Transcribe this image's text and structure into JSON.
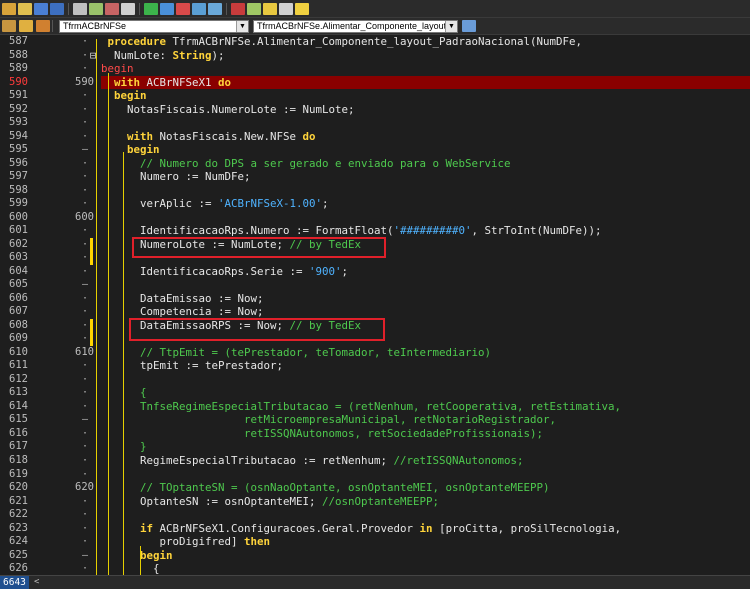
{
  "toolbar": {
    "class_combo": "TfrmACBrNFSe",
    "method_combo": "TfrmACBrNFSe.Alimentar_Componente_layout_Padr"
  },
  "editor": {
    "lines": [
      {
        "n": "587",
        "bm": "",
        "mk": "·",
        "chg": false,
        "bp": false,
        "code": [
          {
            "t": " "
          },
          {
            "t": "procedure",
            "c": "kw"
          },
          {
            "t": " TfrmACBrNFSe.Alimentar_Componente_layout_PadraoNacional(NumDFe,"
          }
        ]
      },
      {
        "n": "588",
        "bm": "",
        "mk": "·",
        "box": "⊟",
        "chg": false,
        "bp": false,
        "code": [
          {
            "t": "  NumLote: "
          },
          {
            "t": "String",
            "c": "kw"
          },
          {
            "t": ");"
          }
        ]
      },
      {
        "n": "589",
        "bm": "",
        "mk": "·",
        "chg": false,
        "bp": false,
        "code": [
          {
            "t": "begin",
            "c": "bp"
          }
        ]
      },
      {
        "n": "590",
        "bm": "590",
        "mk": "·",
        "chg": false,
        "bp": true,
        "code": [
          {
            "t": "  "
          },
          {
            "t": "with",
            "c": "kw"
          },
          {
            "t": " ACBrNFSeX1 "
          },
          {
            "t": "do",
            "c": "kw"
          }
        ]
      },
      {
        "n": "591",
        "bm": "",
        "mk": "·",
        "chg": false,
        "bp": false,
        "code": [
          {
            "t": "  "
          },
          {
            "t": "begin",
            "c": "kw"
          }
        ]
      },
      {
        "n": "592",
        "bm": "",
        "mk": "·",
        "chg": false,
        "bp": false,
        "code": [
          {
            "t": "    NotasFiscais.NumeroLote := NumLote;"
          }
        ]
      },
      {
        "n": "593",
        "bm": "",
        "mk": "·",
        "chg": false,
        "bp": false,
        "code": []
      },
      {
        "n": "594",
        "bm": "",
        "mk": "·",
        "chg": false,
        "bp": false,
        "code": [
          {
            "t": "    "
          },
          {
            "t": "with",
            "c": "kw"
          },
          {
            "t": " NotasFiscais.New.NFSe "
          },
          {
            "t": "do",
            "c": "kw"
          }
        ]
      },
      {
        "n": "595",
        "bm": "",
        "mk": "–",
        "chg": false,
        "bp": false,
        "code": [
          {
            "t": "    "
          },
          {
            "t": "begin",
            "c": "kw"
          }
        ]
      },
      {
        "n": "596",
        "bm": "",
        "mk": "·",
        "chg": false,
        "bp": false,
        "code": [
          {
            "t": "      "
          },
          {
            "t": "// Numero do DPS a ser gerado e enviado para o WebService",
            "c": "cmt"
          }
        ]
      },
      {
        "n": "597",
        "bm": "",
        "mk": "·",
        "chg": false,
        "bp": false,
        "code": [
          {
            "t": "      Numero := NumDFe;"
          }
        ]
      },
      {
        "n": "598",
        "bm": "",
        "mk": "·",
        "chg": false,
        "bp": false,
        "code": []
      },
      {
        "n": "599",
        "bm": "",
        "mk": "·",
        "chg": false,
        "bp": false,
        "code": [
          {
            "t": "      verAplic := "
          },
          {
            "t": "'ACBrNFSeX-1.00'",
            "c": "str"
          },
          {
            "t": ";"
          }
        ]
      },
      {
        "n": "600",
        "bm": "600",
        "mk": "·",
        "chg": false,
        "bp": false,
        "code": []
      },
      {
        "n": "601",
        "bm": "",
        "mk": "·",
        "chg": false,
        "bp": false,
        "code": [
          {
            "t": "      IdentificacaoRps.Numero := FormatFloat("
          },
          {
            "t": "'#########0'",
            "c": "str"
          },
          {
            "t": ", StrToInt(NumDFe));"
          }
        ]
      },
      {
        "n": "602",
        "bm": "",
        "mk": "·",
        "chg": true,
        "bp": false,
        "code": [
          {
            "t": "      NumeroLote := NumLote; "
          },
          {
            "t": "// by TedEx",
            "c": "cmt"
          }
        ]
      },
      {
        "n": "603",
        "bm": "",
        "mk": "·",
        "chg": true,
        "bp": false,
        "code": []
      },
      {
        "n": "604",
        "bm": "",
        "mk": "·",
        "chg": false,
        "bp": false,
        "code": [
          {
            "t": "      IdentificacaoRps.Serie := "
          },
          {
            "t": "'900'",
            "c": "str"
          },
          {
            "t": ";"
          }
        ]
      },
      {
        "n": "605",
        "bm": "",
        "mk": "–",
        "chg": false,
        "bp": false,
        "code": []
      },
      {
        "n": "606",
        "bm": "",
        "mk": "·",
        "chg": false,
        "bp": false,
        "code": [
          {
            "t": "      DataEmissao := Now;"
          }
        ]
      },
      {
        "n": "607",
        "bm": "",
        "mk": "·",
        "chg": false,
        "bp": false,
        "code": [
          {
            "t": "      Competencia := Now;"
          }
        ]
      },
      {
        "n": "608",
        "bm": "",
        "mk": "·",
        "chg": true,
        "bp": false,
        "code": [
          {
            "t": "      DataEmissaoRPS := Now; "
          },
          {
            "t": "// by TedEx",
            "c": "cmt"
          }
        ]
      },
      {
        "n": "609",
        "bm": "",
        "mk": "·",
        "chg": true,
        "bp": false,
        "code": []
      },
      {
        "n": "610",
        "bm": "610",
        "mk": "·",
        "chg": false,
        "bp": false,
        "code": [
          {
            "t": "      "
          },
          {
            "t": "// TtpEmit = (tePrestador, teTomador, teIntermediario)",
            "c": "cmt"
          }
        ]
      },
      {
        "n": "611",
        "bm": "",
        "mk": "·",
        "chg": false,
        "bp": false,
        "code": [
          {
            "t": "      tpEmit := tePrestador;"
          }
        ]
      },
      {
        "n": "612",
        "bm": "",
        "mk": "·",
        "chg": false,
        "bp": false,
        "code": []
      },
      {
        "n": "613",
        "bm": "",
        "mk": "·",
        "chg": false,
        "bp": false,
        "code": [
          {
            "t": "      "
          },
          {
            "t": "{",
            "c": "cmt"
          }
        ]
      },
      {
        "n": "614",
        "bm": "",
        "mk": "·",
        "chg": false,
        "bp": false,
        "code": [
          {
            "t": "      "
          },
          {
            "t": "TnfseRegimeEspecialTributacao = (retNenhum, retCooperativa, retEstimativa,",
            "c": "cmt"
          }
        ]
      },
      {
        "n": "615",
        "bm": "",
        "mk": "–",
        "chg": false,
        "bp": false,
        "code": [
          {
            "t": "                      retMicroempresaMunicipal, retNotarioRegistrador,",
            "c": "cmt"
          }
        ]
      },
      {
        "n": "616",
        "bm": "",
        "mk": "·",
        "chg": false,
        "bp": false,
        "code": [
          {
            "t": "                      retISSQNAutonomos, retSociedadeProfissionais);",
            "c": "cmt"
          }
        ]
      },
      {
        "n": "617",
        "bm": "",
        "mk": "·",
        "chg": false,
        "bp": false,
        "code": [
          {
            "t": "      "
          },
          {
            "t": "}",
            "c": "cmt"
          }
        ]
      },
      {
        "n": "618",
        "bm": "",
        "mk": "·",
        "chg": false,
        "bp": false,
        "code": [
          {
            "t": "      RegimeEspecialTributacao := retNenhum; "
          },
          {
            "t": "//retISSQNAutonomos;",
            "c": "cmt"
          }
        ]
      },
      {
        "n": "619",
        "bm": "",
        "mk": "·",
        "chg": false,
        "bp": false,
        "code": []
      },
      {
        "n": "620",
        "bm": "620",
        "mk": "·",
        "chg": false,
        "bp": false,
        "code": [
          {
            "t": "      "
          },
          {
            "t": "// TOptanteSN = (osnNaoOptante, osnOptanteMEI, osnOptanteMEEPP)",
            "c": "cmt"
          }
        ]
      },
      {
        "n": "621",
        "bm": "",
        "mk": "·",
        "chg": false,
        "bp": false,
        "code": [
          {
            "t": "      OptanteSN := osnOptanteMEI; "
          },
          {
            "t": "//osnOptanteMEEPP;",
            "c": "cmt"
          }
        ]
      },
      {
        "n": "622",
        "bm": "",
        "mk": "·",
        "chg": false,
        "bp": false,
        "code": []
      },
      {
        "n": "623",
        "bm": "",
        "mk": "·",
        "chg": false,
        "bp": false,
        "code": [
          {
            "t": "      "
          },
          {
            "t": "if",
            "c": "kw"
          },
          {
            "t": " ACBrNFSeX1.Configuracoes.Geral.Provedor "
          },
          {
            "t": "in",
            "c": "kw"
          },
          {
            "t": " [proCitta, proSilTecnologia,"
          }
        ]
      },
      {
        "n": "624",
        "bm": "",
        "mk": "·",
        "chg": false,
        "bp": false,
        "code": [
          {
            "t": "         proDigifred] "
          },
          {
            "t": "then",
            "c": "kw"
          }
        ]
      },
      {
        "n": "625",
        "bm": "",
        "mk": "–",
        "chg": false,
        "bp": false,
        "code": [
          {
            "t": "      "
          },
          {
            "t": "begin",
            "c": "kw"
          }
        ]
      },
      {
        "n": "626",
        "bm": "",
        "mk": "·",
        "chg": false,
        "bp": false,
        "code": [
          {
            "t": "        {"
          }
        ]
      }
    ]
  },
  "statusbar": {
    "line_count": "6643",
    "scroll_left": "<"
  }
}
